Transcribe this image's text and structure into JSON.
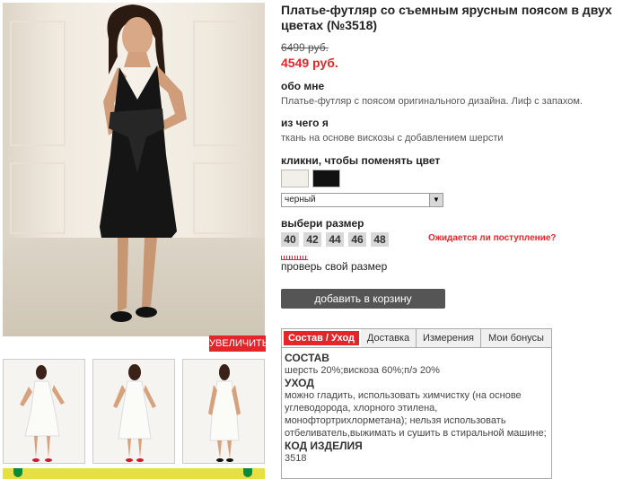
{
  "product": {
    "title": "Платье-футляр со съемным ярусным поясом в двух цветах (№3518)",
    "old_price": "6499 руб.",
    "new_price": "4549 руб."
  },
  "gallery": {
    "enlarge_label": "УВЕЛИЧИТЬ"
  },
  "about": {
    "heading": "обо мне",
    "text": "Платье-футляр с поясом оригинального дизайна. Лиф с запахом."
  },
  "material": {
    "heading": "из чего я",
    "text": "ткань на основе вискозы с добавлением шерсти"
  },
  "color": {
    "heading": "кликни, чтобы поменять цвет",
    "selected": "черный",
    "swatches": [
      "#f1efe8",
      "#111111"
    ]
  },
  "size": {
    "heading": "выбери размер",
    "options": [
      "40",
      "42",
      "44",
      "46",
      "48"
    ],
    "awaiting_link": "Ожидается ли поступление?",
    "check_size_link": "проверь свой размер"
  },
  "cart": {
    "button_label": "добавить в корзину"
  },
  "tabs": {
    "items": [
      "Состав / Уход",
      "Доставка",
      "Измерения",
      "Мои бонусы"
    ],
    "composition_label": "СОСТАВ",
    "composition_text": "шерсть 20%;вискоза 60%;п/э 20%",
    "care_label": "УХОД",
    "care_text": "можно гладить, использовать химчистку (на основе углеводорода, хлорного этилена, монофтортрихлорметана); нельзя использовать отбеливатель,выжимать и сушить в стиральной машине;",
    "code_label": "КОД ИЗДЕЛИЯ",
    "code_value": "3518"
  },
  "colors": {
    "accent": "#e4262b",
    "button": "#555555",
    "size_bg": "#d8d8d8"
  }
}
